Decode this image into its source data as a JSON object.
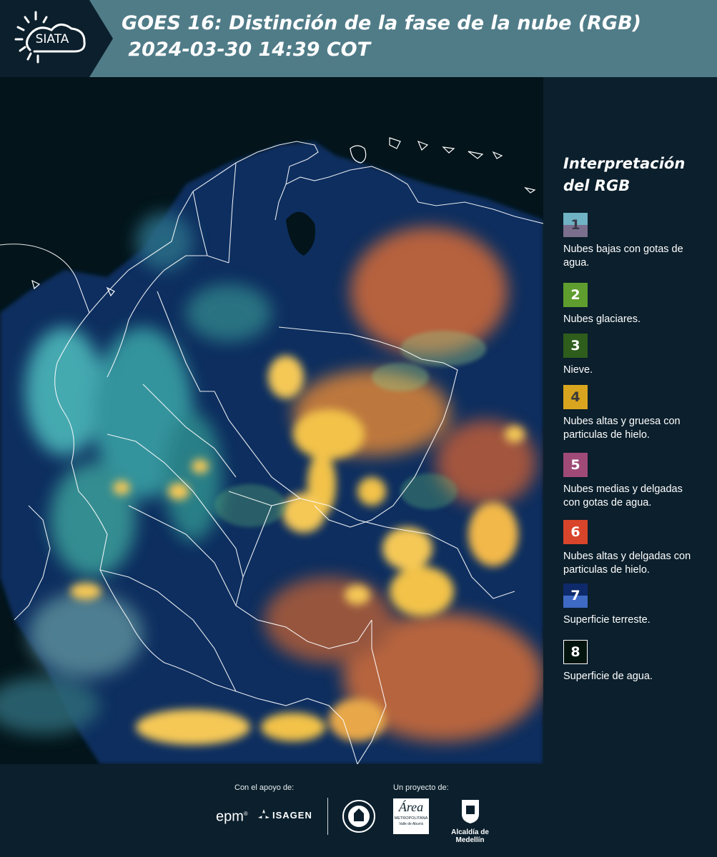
{
  "header": {
    "logo_text": "SIATA",
    "title_line1": "GOES 16: Distinción de la fase de la nube (RGB)",
    "title_line2": " 2024-03-30 14:39 COT"
  },
  "legend": {
    "title": "Interpretación\ndel RGB",
    "items": [
      {
        "number": "1",
        "label": "Nubes bajas con gotas de agua.",
        "color_top": "#6fb3c4",
        "color_bottom": "#7a6f8c"
      },
      {
        "number": "2",
        "label": "Nubes glaciares.",
        "color_top": "#5f9e2e",
        "color_bottom": "#5f9e2e"
      },
      {
        "number": "3",
        "label": "Nieve.",
        "color_top": "#2e5d1c",
        "color_bottom": "#2e5d1c"
      },
      {
        "number": "4",
        "label": "Nubes altas y gruesa con particulas de hielo.",
        "color_top": "#d9a51e",
        "color_bottom": "#d9a51e"
      },
      {
        "number": "5",
        "label": "Nubes medias y delgadas con gotas de agua.",
        "color_top": "#a04a78",
        "color_bottom": "#a04a78"
      },
      {
        "number": "6",
        "label": "Nubes altas y delgadas con particulas de hielo.",
        "color_top": "#d9452a",
        "color_bottom": "#d9452a"
      },
      {
        "number": "7",
        "label": "Superficie terreste.",
        "color_top": "#0e2a6a",
        "color_bottom": "#3e6ac4"
      },
      {
        "number": "8",
        "label": "Superficie de agua.",
        "color_top": "#03140f",
        "color_bottom": "#03140f"
      }
    ]
  },
  "footer": {
    "support_label": "Con el apoyo de:",
    "project_label": "Un proyecto de:",
    "sponsor_epm": "epm",
    "sponsor_isagen": "ISAGEN",
    "partner_area": "Área",
    "partner_area_sub": "METROPOLITANA",
    "partner_area_sub2": "Valle de Aburrá",
    "partner_alcaldia": "Alcaldía de Medellín"
  }
}
